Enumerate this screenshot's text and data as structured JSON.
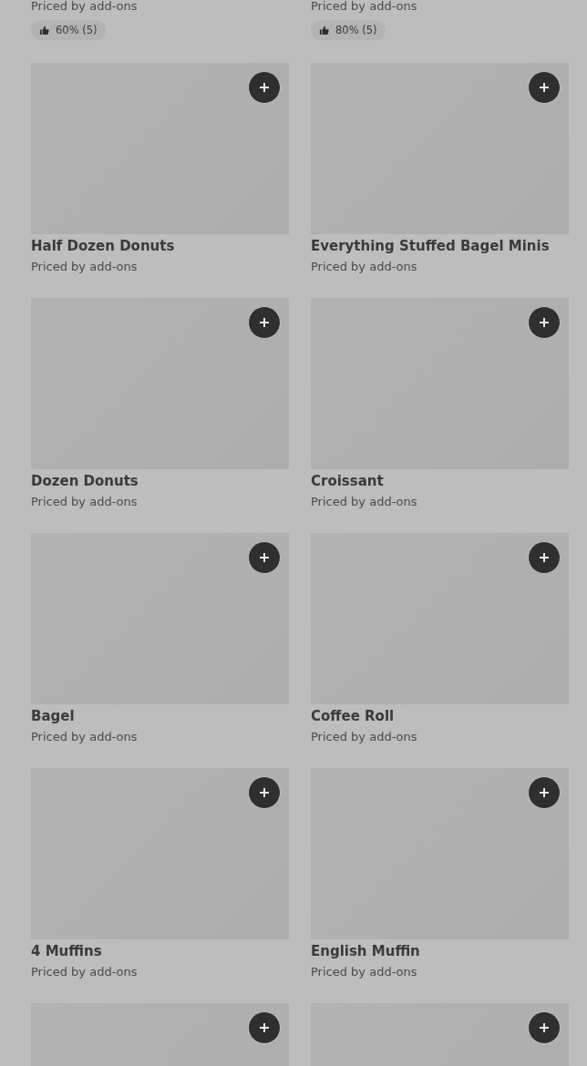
{
  "top_items": [
    {
      "price": "Priced by add-ons",
      "rating": "60% (5)"
    },
    {
      "price": "Priced by add-ons",
      "rating": "80% (5)"
    }
  ],
  "items": [
    {
      "kind": "card",
      "name": "Half Dozen Donuts",
      "price": "Priced by add-ons"
    },
    {
      "kind": "card",
      "name": "Everything Stuffed Bagel Minis",
      "price": "Priced by add-ons"
    },
    {
      "kind": "card",
      "name": "Dozen Donuts",
      "price": "Priced by add-ons"
    },
    {
      "kind": "card",
      "name": "Croissant",
      "price": "Priced by add-ons"
    },
    {
      "kind": "card",
      "name": "Bagel",
      "price": "Priced by add-ons"
    },
    {
      "kind": "card",
      "name": "Coffee Roll",
      "price": "Priced by add-ons"
    },
    {
      "kind": "card",
      "name": "4 Muffins",
      "price": "Priced by add-ons"
    },
    {
      "kind": "card",
      "name": "English Muffin",
      "price": "Priced by add-ons"
    },
    {
      "kind": "partial"
    },
    {
      "kind": "partial"
    }
  ]
}
